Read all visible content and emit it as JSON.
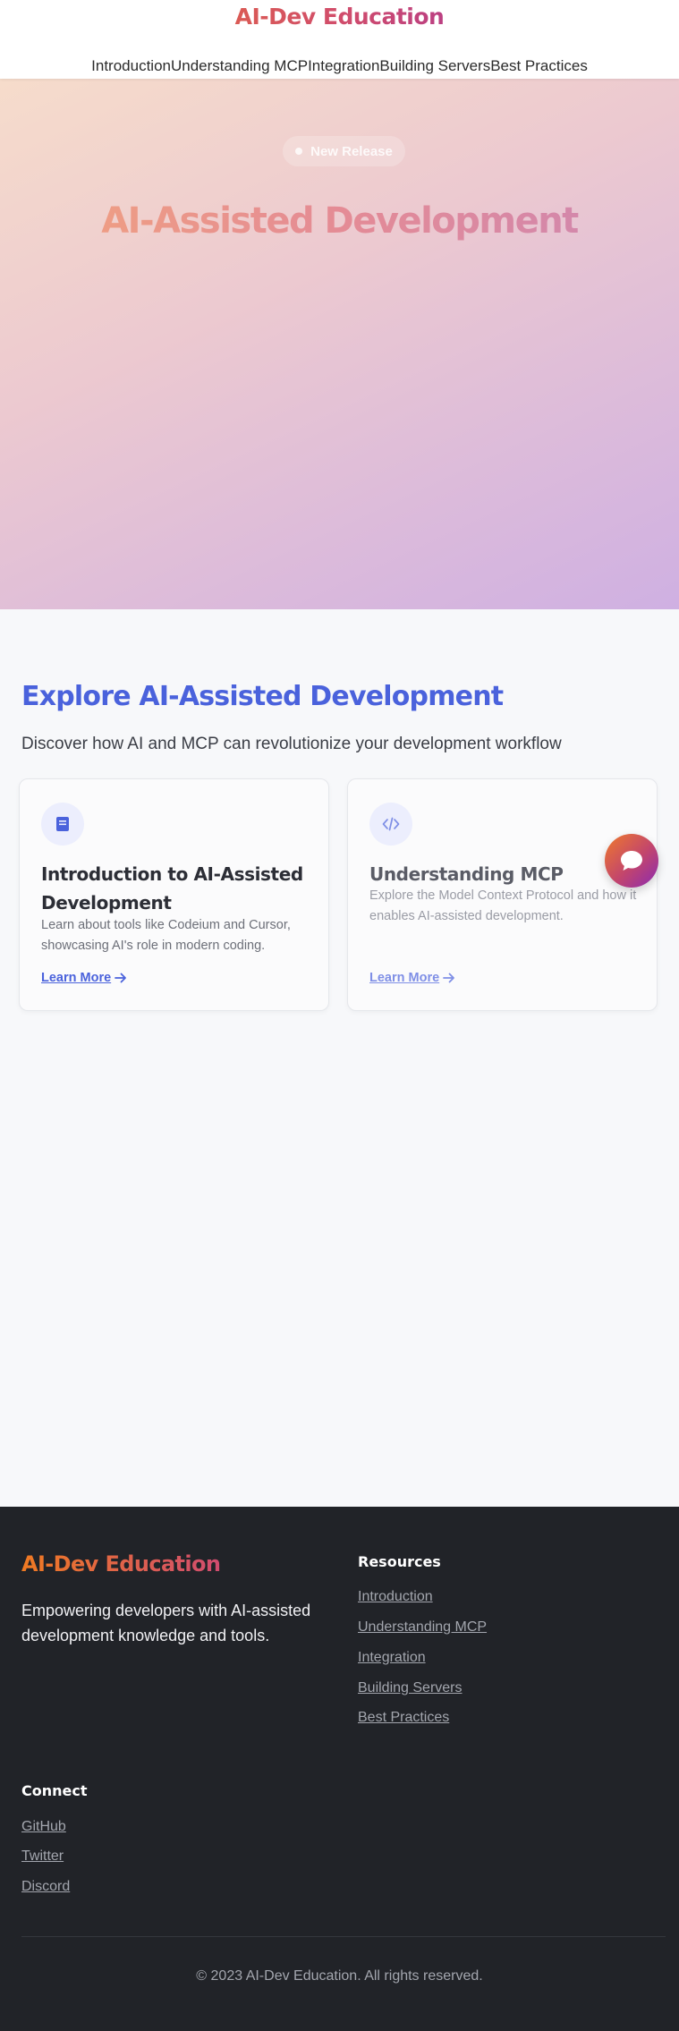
{
  "header": {
    "brand": "AI-Dev Education",
    "nav": [
      {
        "label": "Introduction"
      },
      {
        "label": "Understanding MCP"
      },
      {
        "label": "Integration"
      },
      {
        "label": "Building Servers"
      },
      {
        "label": "Best Practices"
      }
    ]
  },
  "hero": {
    "badge": "New Release",
    "title": "AI-Assisted Development"
  },
  "explore": {
    "title": "Explore AI-Assisted Development",
    "subtitle": "Discover how AI and MCP can revolutionize your development workflow",
    "cards": [
      {
        "icon": "book-icon",
        "title": "Introduction to AI-Assisted Development",
        "description": "Learn about tools like Codeium and Cursor, showcasing AI's role in modern coding.",
        "link": "Learn More"
      },
      {
        "icon": "code-icon",
        "title": "Understanding MCP",
        "description": "Explore the Model Context Protocol and how it enables AI-assisted development.",
        "link": "Learn More"
      }
    ]
  },
  "chat": {
    "icon": "chat-bubble-icon"
  },
  "footer": {
    "brand": "AI-Dev Education",
    "tagline": "Empowering developers with AI-assisted development knowledge and tools.",
    "resources": {
      "heading": "Resources",
      "links": [
        "Introduction",
        "Understanding MCP",
        "Integration",
        "Building Servers",
        "Best Practices"
      ]
    },
    "connect": {
      "heading": "Connect",
      "links": [
        "GitHub",
        "Twitter",
        "Discord"
      ]
    },
    "copyright": "© 2023 AI-Dev Education. All rights reserved."
  },
  "colors": {
    "accent": "#4a62dc",
    "brand_orange": "#ef7a22",
    "brand_purple": "#8a22b6",
    "footer_bg": "#212328"
  }
}
